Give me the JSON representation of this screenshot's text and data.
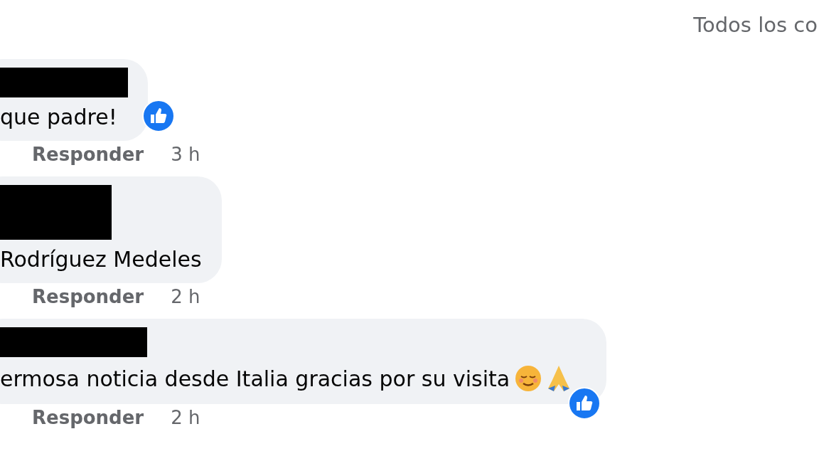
{
  "header": {
    "filter_label": "Todos los co"
  },
  "comments": [
    {
      "kind": "plain",
      "text": "que padre!",
      "liked": true,
      "reply_label": "Responder",
      "time": "3 h"
    },
    {
      "kind": "plain",
      "text": "Rodríguez Medeles",
      "liked": false,
      "reply_label": "Responder",
      "time": "2 h"
    },
    {
      "kind": "emoji",
      "text": "ermosa noticia desde Italia gracias por su visita",
      "liked": true,
      "reply_label": "Responder",
      "time": "2 h"
    }
  ]
}
